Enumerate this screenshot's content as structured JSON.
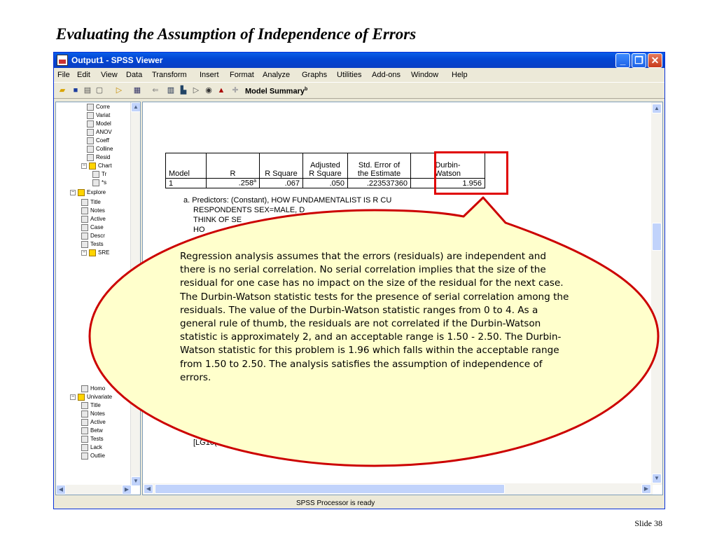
{
  "slide": {
    "title": "Evaluating the Assumption of Independence of Errors",
    "slide_number": "Slide 38"
  },
  "window": {
    "title": "Output1 - SPSS Viewer",
    "buttons": {
      "minimize": "_",
      "maximize": "❐",
      "close": "✕"
    }
  },
  "menu": {
    "items": [
      "File",
      "Edit",
      "View",
      "Data",
      "Transform",
      "Insert",
      "Format",
      "Analyze",
      "Graphs",
      "Utilities",
      "Add-ons",
      "Window",
      "Help"
    ]
  },
  "toolbar": {
    "icons": [
      "open-icon",
      "save-icon",
      "print-icon",
      "print-preview-icon",
      "export-icon",
      "dialog-recall-icon",
      "undo-icon",
      "goto-data-icon",
      "variables-icon",
      "insert-heading-icon",
      "insert-title-icon",
      "insert-text-icon",
      "show-icon",
      "hide-icon"
    ]
  },
  "tree": {
    "rows": [
      {
        "label": "Corre",
        "kind": "doc"
      },
      {
        "label": "Variat",
        "kind": "doc"
      },
      {
        "label": "Model",
        "kind": "doc"
      },
      {
        "label": "ANOV",
        "kind": "doc"
      },
      {
        "label": "Coeff",
        "kind": "doc"
      },
      {
        "label": "Colline",
        "kind": "doc"
      },
      {
        "label": "Resid",
        "kind": "doc"
      },
      {
        "label": "Chart",
        "kind": "folder"
      },
      {
        "label": "Tr",
        "kind": "doc"
      },
      {
        "label": "*s",
        "kind": "doc"
      },
      {
        "label": "Explore",
        "kind": "folder"
      },
      {
        "label": "Title",
        "kind": "doc"
      },
      {
        "label": "Notes",
        "kind": "doc"
      },
      {
        "label": "Active",
        "kind": "doc"
      },
      {
        "label": "Case",
        "kind": "doc"
      },
      {
        "label": "Descr",
        "kind": "doc"
      },
      {
        "label": "Tests",
        "kind": "doc"
      },
      {
        "label": "SRE",
        "kind": "folder"
      },
      {
        "label": "Homo",
        "kind": "doc"
      },
      {
        "label": "Univariate",
        "kind": "folder"
      },
      {
        "label": "Title",
        "kind": "doc"
      },
      {
        "label": "Notes",
        "kind": "doc"
      },
      {
        "label": "Active",
        "kind": "doc"
      },
      {
        "label": "Betw",
        "kind": "doc"
      },
      {
        "label": "Tests",
        "kind": "doc"
      },
      {
        "label": "Lack",
        "kind": "doc"
      },
      {
        "label": "Outlie",
        "kind": "doc"
      }
    ]
  },
  "model_summary": {
    "title": "Model Summary",
    "title_sup": "b",
    "headers": [
      "Model",
      "R",
      "R Square",
      "Adjusted R Square",
      "Std. Error of the Estimate",
      "Durbin-Watson"
    ],
    "header_lines": {
      "adjusted": [
        "Adjusted",
        "R Square"
      ],
      "std_error": [
        "Std. Error of",
        "the Estimate"
      ],
      "durbin": [
        "Durbin-",
        "Watson"
      ]
    },
    "row": {
      "model": "1",
      "r": ".258",
      "r_sup": "a",
      "r_square": ".067",
      "adjusted_r_square": ".050",
      "std_error": ".223537360",
      "durbin_watson": "1.956"
    },
    "footnotes": [
      "a. Predictors: (Constant), HOW FUNDAMENTALIST IS R CU",
      "RESPONDENTS SEX=MALE, D",
      "THINK OF SE",
      "HO"
    ],
    "footnote_tail": "[LG10("
  },
  "callout": {
    "text": "Regression analysis assumes that the errors (residuals) are independent and there is no serial correlation. No serial correlation implies that the size of the residual for one case has no impact on the size of the residual for the next case. The Durbin-Watson statistic tests for the presence of serial correlation among the residuals. The value of the Durbin-Watson statistic ranges from 0 to 4. As a general rule of thumb, the residuals are not correlated if the Durbin-Watson statistic is approximately 2, and an acceptable range is 1.50 - 2.50. The Durbin-Watson statistic for this problem is 1.96 which falls within the acceptable range from 1.50 to 2.50. The analysis satisfies  the assumption of independence of errors.",
    "fill_color": "#ffffcc",
    "stroke_color": "#cc0000"
  },
  "status": {
    "text": "SPSS Processor is ready"
  }
}
